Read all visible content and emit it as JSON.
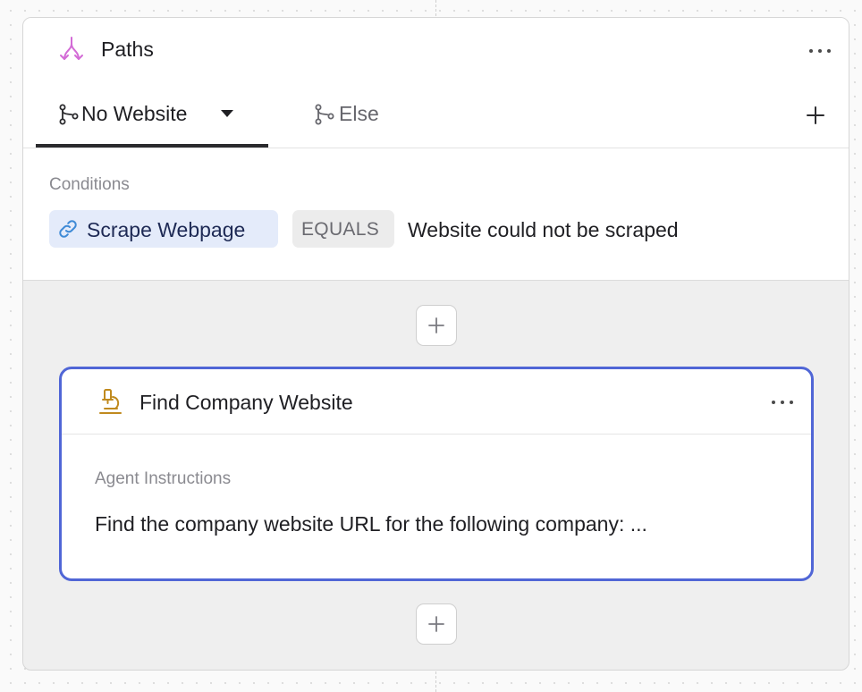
{
  "paths": {
    "title": "Paths",
    "icon": "paths-split-icon",
    "accent": "#d36bd6",
    "tabs": [
      {
        "label": "No Website",
        "icon": "branch-icon",
        "active": true
      },
      {
        "label": "Else",
        "icon": "branch-icon",
        "active": false
      }
    ],
    "conditions": {
      "label": "Conditions",
      "field": "Scrape Webpage",
      "field_icon": "link-icon",
      "operator": "EQUALS",
      "value": "Website could not be scraped"
    }
  },
  "step": {
    "title": "Find Company Website",
    "icon": "microscope-icon",
    "accent": "#c08a1e",
    "border_color": "#5066d6",
    "instructions_label": "Agent Instructions",
    "instructions_text": "Find the company website URL for the following company: ..."
  }
}
